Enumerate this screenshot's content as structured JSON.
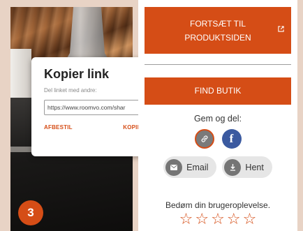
{
  "step_badge": "3",
  "popup": {
    "title": "Kopier link",
    "subtitle": "Del linket med andre:",
    "link_value": "https://www.roomvo.com/shar",
    "cancel_label": "AFBESTIL",
    "copy_label": "KOPIER LINK"
  },
  "panel": {
    "continue_line1": "FORTSÆT TIL",
    "continue_line2": "PRODUKTSIDEN",
    "continue_icon": "external-link-icon",
    "find_store": "FIND BUTIK",
    "share_title": "Gem og del:",
    "share_icons": [
      "link-icon",
      "facebook-icon"
    ],
    "facebook_letter": "f",
    "email_label": "Email",
    "download_label": "Hent",
    "rate_text": "Bedøm din brugeroplevelse.",
    "star_count": 5
  },
  "colors": {
    "accent": "#d54d16",
    "facebook": "#3b5aa0",
    "background": "#e8d3c5"
  }
}
